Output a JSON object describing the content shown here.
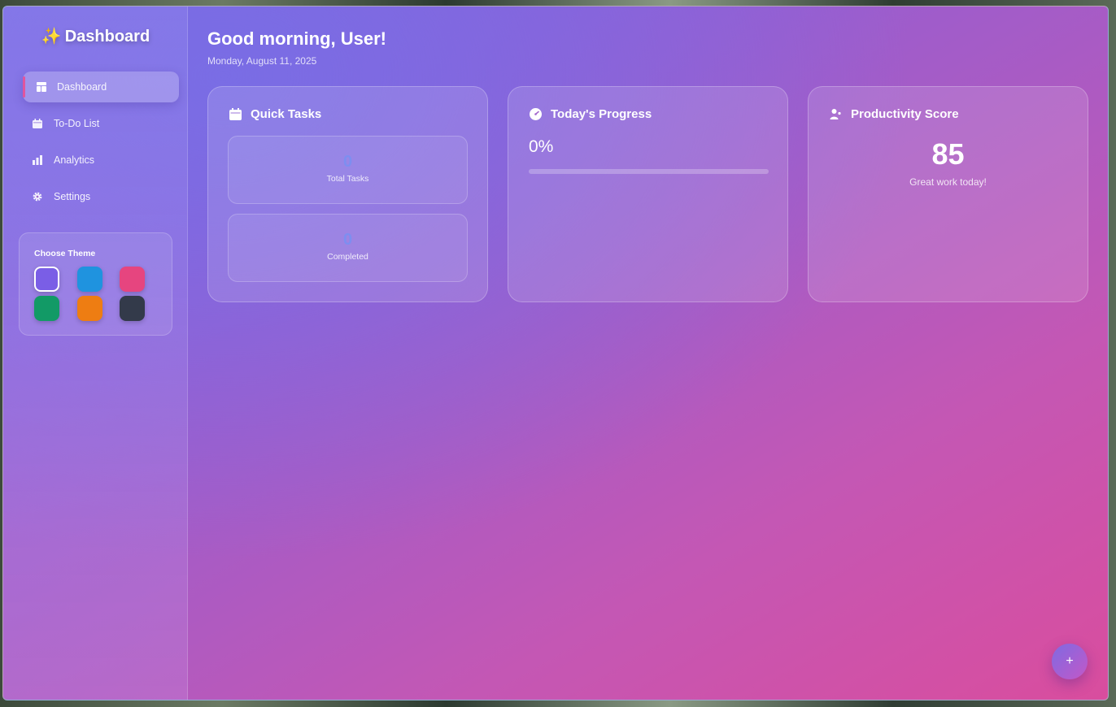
{
  "sidebar": {
    "brand_emoji": "✨",
    "brand_title": "Dashboard",
    "items": [
      {
        "label": "Dashboard",
        "icon": "layout-icon",
        "active": true
      },
      {
        "label": "To-Do List",
        "icon": "calendar-icon",
        "active": false
      },
      {
        "label": "Analytics",
        "icon": "bar-chart-icon",
        "active": false
      },
      {
        "label": "Settings",
        "icon": "gear-icon",
        "active": false
      }
    ],
    "theme": {
      "title": "Choose Theme",
      "swatches": [
        {
          "name": "purple",
          "color": "#7a5ee6",
          "selected": true
        },
        {
          "name": "blue",
          "color": "#1f93df",
          "selected": false
        },
        {
          "name": "pink",
          "color": "#e6457f",
          "selected": false
        },
        {
          "name": "green",
          "color": "#129a66",
          "selected": false
        },
        {
          "name": "orange",
          "color": "#ee7d12",
          "selected": false
        },
        {
          "name": "dark",
          "color": "#333a4a",
          "selected": false
        }
      ]
    }
  },
  "header": {
    "greeting": "Good morning, User!",
    "date": "Monday, August 11, 2025"
  },
  "cards": {
    "quick_tasks": {
      "title": "Quick Tasks",
      "total_value": "0",
      "total_label": "Total Tasks",
      "completed_value": "0",
      "completed_label": "Completed"
    },
    "progress": {
      "title": "Today's Progress",
      "percent_text": "0%",
      "percent_value": 0
    },
    "productivity": {
      "title": "Productivity Score",
      "score": "85",
      "subtitle": "Great work today!"
    }
  },
  "fab": {
    "label": "+"
  },
  "colors": {
    "accent": "#e0559e",
    "stat_number": "#7d8ef0"
  }
}
